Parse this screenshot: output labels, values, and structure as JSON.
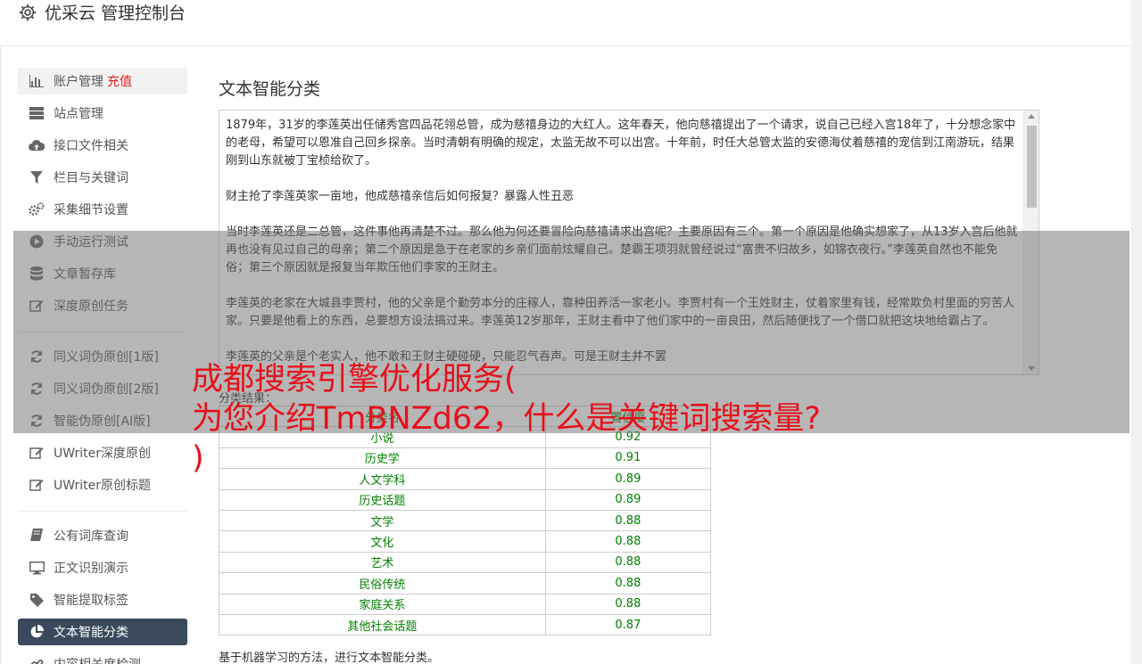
{
  "header": {
    "title": "优采云 管理控制台",
    "icon": "gear-icon"
  },
  "sidebar": {
    "items": [
      {
        "label": "账户管理",
        "extra": "充值",
        "icon": "bar-chart-icon"
      },
      {
        "label": "站点管理",
        "icon": "server-icon"
      },
      {
        "label": "接口文件相关",
        "icon": "cloud-upload-icon"
      },
      {
        "label": "栏目与关键词",
        "icon": "filter-icon"
      },
      {
        "label": "采集细节设置",
        "icon": "cogs-icon"
      },
      {
        "label": "手动运行测试",
        "icon": "play-icon"
      },
      {
        "label": "文章暂存库",
        "icon": "database-icon"
      },
      {
        "label": "深度原创任务",
        "icon": "edit-icon"
      },
      {
        "label": "同义词伪原创[1版]",
        "icon": "refresh-icon"
      },
      {
        "label": "同义词伪原创[2版]",
        "icon": "refresh-icon"
      },
      {
        "label": "智能伪原创[AI版]",
        "icon": "refresh-icon"
      },
      {
        "label": "UWriter深度原创",
        "icon": "edit-icon"
      },
      {
        "label": "UWriter原创标题",
        "icon": "edit-icon"
      },
      {
        "label": "公有词库查询",
        "icon": "book-icon"
      },
      {
        "label": "正文识别演示",
        "icon": "monitor-icon"
      },
      {
        "label": "智能提取标签",
        "icon": "tag-icon"
      },
      {
        "label": "文本智能分类",
        "icon": "pie-chart-icon"
      },
      {
        "label": "内容相关度检测",
        "icon": "link-icon"
      }
    ]
  },
  "main": {
    "title": "文本智能分类",
    "article": [
      "1879年，31岁的李莲英出任储秀宫四品花翎总管，成为慈禧身边的大红人。这年春天，他向慈禧提出了一个请求，说自己已经入宫18年了，十分想念家中的老母，希望可以恩准自己回乡探亲。当时清朝有明确的规定，太监无故不可以出宫。十年前，时任大总管太监的安德海仗着慈禧的宠信到江南游玩，结果刚到山东就被丁宝桢给砍了。",
      "财主抢了李莲英家一亩地，他成慈禧亲信后如何报复？暴露人性丑恶",
      "当时李莲英还是二总管，这件事他再清楚不过。那么他为何还要冒险向慈禧请求出宫呢？主要原因有三个。第一个原因是他确实想家了，从13岁入宫后他就再也没有见过自己的母亲；第二个原因是急于在老家的乡亲们面前炫耀自己。楚霸王项羽就曾经说过“富贵不归故乡，如锦衣夜行。”李莲英自然也不能免俗；第三个原因就是报复当年欺压他们李家的王财主。",
      "李莲英的老家在大城县李贾村，他的父亲是个勤劳本分的庄稼人，靠种田养活一家老小。李贾村有一个王姓财主，仗着家里有钱，经常欺负村里面的穷苦人家。只要是他看上的东西，总要想方设法搞过来。李莲英12岁那年，王财主看中了他们家中的一亩良田，然后随便找了一个借口就把这块地给霸占了。",
      "李莲英的父亲是个老实人，他不敢和王财主硬碰硬，只能忍气吞声。可是王财主并不罢"
    ],
    "result_label": "分类结果：",
    "table": {
      "headers": [
        "分类名",
        "置信度"
      ],
      "rows": [
        [
          "小说",
          "0.92"
        ],
        [
          "历史学",
          "0.91"
        ],
        [
          "人文学科",
          "0.89"
        ],
        [
          "历史话题",
          "0.89"
        ],
        [
          "文学",
          "0.88"
        ],
        [
          "文化",
          "0.88"
        ],
        [
          "艺术",
          "0.88"
        ],
        [
          "民俗传统",
          "0.88"
        ],
        [
          "家庭关系",
          "0.88"
        ],
        [
          "其他社会话题",
          "0.87"
        ]
      ]
    },
    "footnote": "基于机器学习的方法，进行文本智能分类。"
  },
  "overlay": {
    "lines": [
      "成都搜索引擎优化服务(",
      "为您介绍TmBNZd62，什么是关键词搜索量?",
      ")"
    ]
  },
  "colors": {
    "accent_red": "#e0201c",
    "active_nav": "#3a4a5c",
    "result_green": "#008000"
  }
}
